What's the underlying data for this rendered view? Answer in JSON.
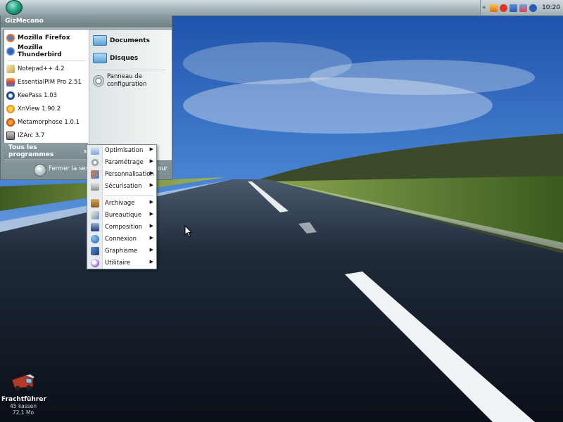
{
  "taskbar": {
    "clock": "10:20",
    "tray_icons": [
      "expand-chevron-icon",
      "flag-icon",
      "shield-icon",
      "network-icon",
      "security-icon",
      "update-icon"
    ]
  },
  "start_menu": {
    "user_name": "GizMecano",
    "pinned": [
      {
        "label": "Mozilla Firefox",
        "icon": "firefox-icon"
      },
      {
        "label": "Mozilla Thunderbird",
        "icon": "thunderbird-icon"
      }
    ],
    "programs": [
      {
        "label": "Notepad++ 4.2",
        "icon": "notepad-icon"
      },
      {
        "label": "EssentialPIM Pro 2.51",
        "icon": "essentialpim-icon"
      },
      {
        "label": "KeePass 1.03",
        "icon": "keepass-icon"
      },
      {
        "label": "XnView 1.90.2",
        "icon": "xnview-icon"
      },
      {
        "label": "Metamorphose 1.0.1",
        "icon": "metamorphose-icon"
      },
      {
        "label": "IZArc 3.7",
        "icon": "izarc-icon"
      }
    ],
    "right": {
      "documents": "Documents",
      "disks": "Disques",
      "control_panel_line1": "Panneau de",
      "control_panel_line2": "configuration"
    },
    "all_programs": "Tous les programmes",
    "all_programs_arrows": "»",
    "logoff": "Fermer la sess",
    "logoff_suffix": "our"
  },
  "submenu": {
    "items": [
      {
        "label": "Optimisation",
        "icon": "optimisation-icon"
      },
      {
        "label": "Paramétrage",
        "icon": "settings-icon"
      },
      {
        "label": "Personnalisation",
        "icon": "personalisation-icon"
      },
      {
        "label": "Sécurisation",
        "icon": "security-icon"
      },
      {
        "label": "Archivage",
        "icon": "archive-icon"
      },
      {
        "label": "Bureautique",
        "icon": "office-icon"
      },
      {
        "label": "Composition",
        "icon": "composition-icon"
      },
      {
        "label": "Connexion",
        "icon": "connection-icon"
      },
      {
        "label": "Graphisme",
        "icon": "graphics-icon"
      },
      {
        "label": "Utilitaire",
        "icon": "utility-icon"
      }
    ],
    "arrow": "▶"
  },
  "desktop_icon": {
    "name": "Frachtführer",
    "line2": "45 kassen",
    "line3": "72,1 Mo"
  },
  "colors": {
    "accent": "#27a584",
    "menu_frame": "#8f9fa4",
    "sky": "#2f6fd0",
    "road": "#141a24"
  }
}
